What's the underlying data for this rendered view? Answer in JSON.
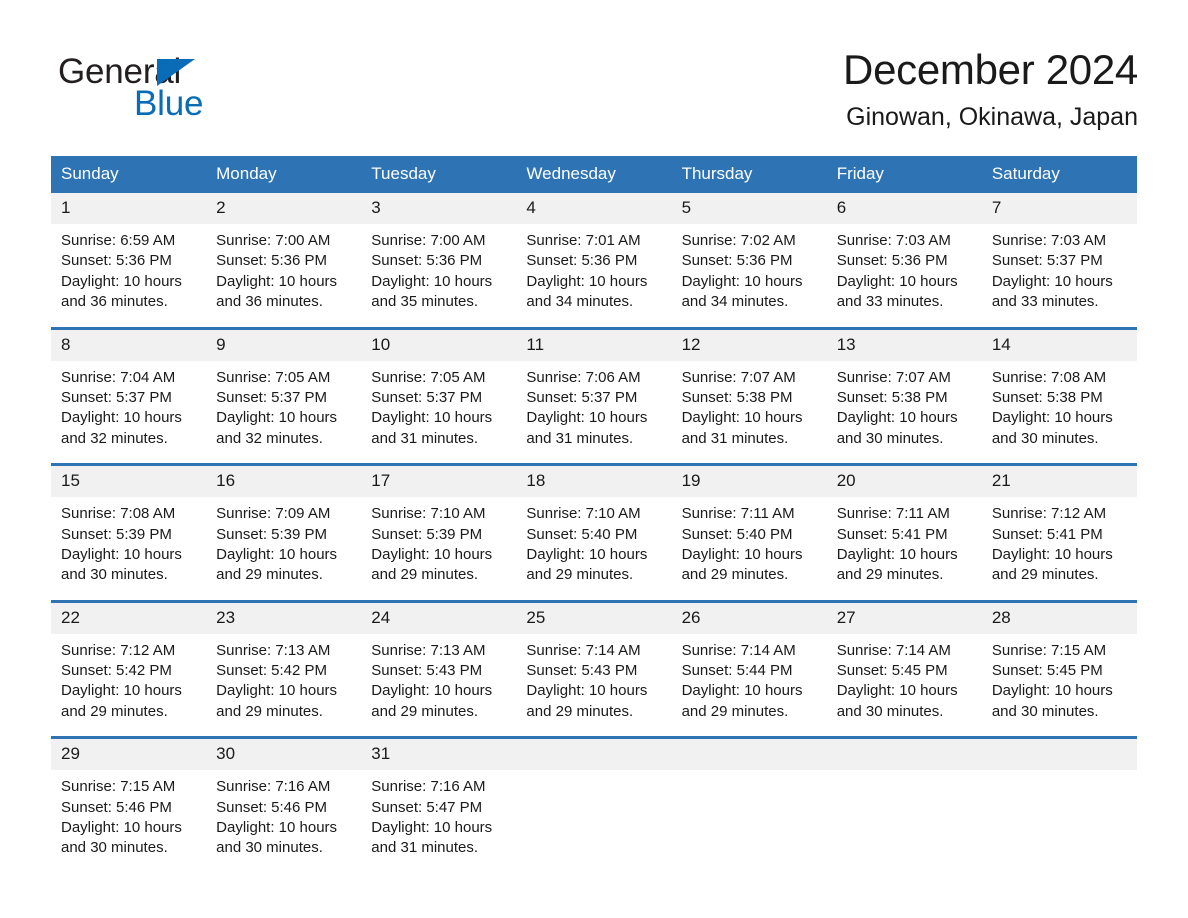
{
  "logo": {
    "word_one": "General",
    "word_two": "Blue",
    "triangle_icon": "triangle-icon",
    "brand_blue": "#0a6cb6"
  },
  "header": {
    "title": "December 2024",
    "subtitle": "Ginowan, Okinawa, Japan"
  },
  "colors": {
    "header_blue": "#2e74b5",
    "daynum_band": "#f1f1f1",
    "text": "#1a1a1a"
  },
  "calendar": {
    "weekday_headers": [
      "Sunday",
      "Monday",
      "Tuesday",
      "Wednesday",
      "Thursday",
      "Friday",
      "Saturday"
    ],
    "weeks": [
      [
        {
          "day": "1",
          "sunrise": "Sunrise: 6:59 AM",
          "sunset": "Sunset: 5:36 PM",
          "daylight_1": "Daylight: 10 hours",
          "daylight_2": "and 36 minutes."
        },
        {
          "day": "2",
          "sunrise": "Sunrise: 7:00 AM",
          "sunset": "Sunset: 5:36 PM",
          "daylight_1": "Daylight: 10 hours",
          "daylight_2": "and 36 minutes."
        },
        {
          "day": "3",
          "sunrise": "Sunrise: 7:00 AM",
          "sunset": "Sunset: 5:36 PM",
          "daylight_1": "Daylight: 10 hours",
          "daylight_2": "and 35 minutes."
        },
        {
          "day": "4",
          "sunrise": "Sunrise: 7:01 AM",
          "sunset": "Sunset: 5:36 PM",
          "daylight_1": "Daylight: 10 hours",
          "daylight_2": "and 34 minutes."
        },
        {
          "day": "5",
          "sunrise": "Sunrise: 7:02 AM",
          "sunset": "Sunset: 5:36 PM",
          "daylight_1": "Daylight: 10 hours",
          "daylight_2": "and 34 minutes."
        },
        {
          "day": "6",
          "sunrise": "Sunrise: 7:03 AM",
          "sunset": "Sunset: 5:36 PM",
          "daylight_1": "Daylight: 10 hours",
          "daylight_2": "and 33 minutes."
        },
        {
          "day": "7",
          "sunrise": "Sunrise: 7:03 AM",
          "sunset": "Sunset: 5:37 PM",
          "daylight_1": "Daylight: 10 hours",
          "daylight_2": "and 33 minutes."
        }
      ],
      [
        {
          "day": "8",
          "sunrise": "Sunrise: 7:04 AM",
          "sunset": "Sunset: 5:37 PM",
          "daylight_1": "Daylight: 10 hours",
          "daylight_2": "and 32 minutes."
        },
        {
          "day": "9",
          "sunrise": "Sunrise: 7:05 AM",
          "sunset": "Sunset: 5:37 PM",
          "daylight_1": "Daylight: 10 hours",
          "daylight_2": "and 32 minutes."
        },
        {
          "day": "10",
          "sunrise": "Sunrise: 7:05 AM",
          "sunset": "Sunset: 5:37 PM",
          "daylight_1": "Daylight: 10 hours",
          "daylight_2": "and 31 minutes."
        },
        {
          "day": "11",
          "sunrise": "Sunrise: 7:06 AM",
          "sunset": "Sunset: 5:37 PM",
          "daylight_1": "Daylight: 10 hours",
          "daylight_2": "and 31 minutes."
        },
        {
          "day": "12",
          "sunrise": "Sunrise: 7:07 AM",
          "sunset": "Sunset: 5:38 PM",
          "daylight_1": "Daylight: 10 hours",
          "daylight_2": "and 31 minutes."
        },
        {
          "day": "13",
          "sunrise": "Sunrise: 7:07 AM",
          "sunset": "Sunset: 5:38 PM",
          "daylight_1": "Daylight: 10 hours",
          "daylight_2": "and 30 minutes."
        },
        {
          "day": "14",
          "sunrise": "Sunrise: 7:08 AM",
          "sunset": "Sunset: 5:38 PM",
          "daylight_1": "Daylight: 10 hours",
          "daylight_2": "and 30 minutes."
        }
      ],
      [
        {
          "day": "15",
          "sunrise": "Sunrise: 7:08 AM",
          "sunset": "Sunset: 5:39 PM",
          "daylight_1": "Daylight: 10 hours",
          "daylight_2": "and 30 minutes."
        },
        {
          "day": "16",
          "sunrise": "Sunrise: 7:09 AM",
          "sunset": "Sunset: 5:39 PM",
          "daylight_1": "Daylight: 10 hours",
          "daylight_2": "and 29 minutes."
        },
        {
          "day": "17",
          "sunrise": "Sunrise: 7:10 AM",
          "sunset": "Sunset: 5:39 PM",
          "daylight_1": "Daylight: 10 hours",
          "daylight_2": "and 29 minutes."
        },
        {
          "day": "18",
          "sunrise": "Sunrise: 7:10 AM",
          "sunset": "Sunset: 5:40 PM",
          "daylight_1": "Daylight: 10 hours",
          "daylight_2": "and 29 minutes."
        },
        {
          "day": "19",
          "sunrise": "Sunrise: 7:11 AM",
          "sunset": "Sunset: 5:40 PM",
          "daylight_1": "Daylight: 10 hours",
          "daylight_2": "and 29 minutes."
        },
        {
          "day": "20",
          "sunrise": "Sunrise: 7:11 AM",
          "sunset": "Sunset: 5:41 PM",
          "daylight_1": "Daylight: 10 hours",
          "daylight_2": "and 29 minutes."
        },
        {
          "day": "21",
          "sunrise": "Sunrise: 7:12 AM",
          "sunset": "Sunset: 5:41 PM",
          "daylight_1": "Daylight: 10 hours",
          "daylight_2": "and 29 minutes."
        }
      ],
      [
        {
          "day": "22",
          "sunrise": "Sunrise: 7:12 AM",
          "sunset": "Sunset: 5:42 PM",
          "daylight_1": "Daylight: 10 hours",
          "daylight_2": "and 29 minutes."
        },
        {
          "day": "23",
          "sunrise": "Sunrise: 7:13 AM",
          "sunset": "Sunset: 5:42 PM",
          "daylight_1": "Daylight: 10 hours",
          "daylight_2": "and 29 minutes."
        },
        {
          "day": "24",
          "sunrise": "Sunrise: 7:13 AM",
          "sunset": "Sunset: 5:43 PM",
          "daylight_1": "Daylight: 10 hours",
          "daylight_2": "and 29 minutes."
        },
        {
          "day": "25",
          "sunrise": "Sunrise: 7:14 AM",
          "sunset": "Sunset: 5:43 PM",
          "daylight_1": "Daylight: 10 hours",
          "daylight_2": "and 29 minutes."
        },
        {
          "day": "26",
          "sunrise": "Sunrise: 7:14 AM",
          "sunset": "Sunset: 5:44 PM",
          "daylight_1": "Daylight: 10 hours",
          "daylight_2": "and 29 minutes."
        },
        {
          "day": "27",
          "sunrise": "Sunrise: 7:14 AM",
          "sunset": "Sunset: 5:45 PM",
          "daylight_1": "Daylight: 10 hours",
          "daylight_2": "and 30 minutes."
        },
        {
          "day": "28",
          "sunrise": "Sunrise: 7:15 AM",
          "sunset": "Sunset: 5:45 PM",
          "daylight_1": "Daylight: 10 hours",
          "daylight_2": "and 30 minutes."
        }
      ],
      [
        {
          "day": "29",
          "sunrise": "Sunrise: 7:15 AM",
          "sunset": "Sunset: 5:46 PM",
          "daylight_1": "Daylight: 10 hours",
          "daylight_2": "and 30 minutes."
        },
        {
          "day": "30",
          "sunrise": "Sunrise: 7:16 AM",
          "sunset": "Sunset: 5:46 PM",
          "daylight_1": "Daylight: 10 hours",
          "daylight_2": "and 30 minutes."
        },
        {
          "day": "31",
          "sunrise": "Sunrise: 7:16 AM",
          "sunset": "Sunset: 5:47 PM",
          "daylight_1": "Daylight: 10 hours",
          "daylight_2": "and 31 minutes."
        },
        {
          "day": "",
          "sunrise": "",
          "sunset": "",
          "daylight_1": "",
          "daylight_2": ""
        },
        {
          "day": "",
          "sunrise": "",
          "sunset": "",
          "daylight_1": "",
          "daylight_2": ""
        },
        {
          "day": "",
          "sunrise": "",
          "sunset": "",
          "daylight_1": "",
          "daylight_2": ""
        },
        {
          "day": "",
          "sunrise": "",
          "sunset": "",
          "daylight_1": "",
          "daylight_2": ""
        }
      ]
    ]
  }
}
